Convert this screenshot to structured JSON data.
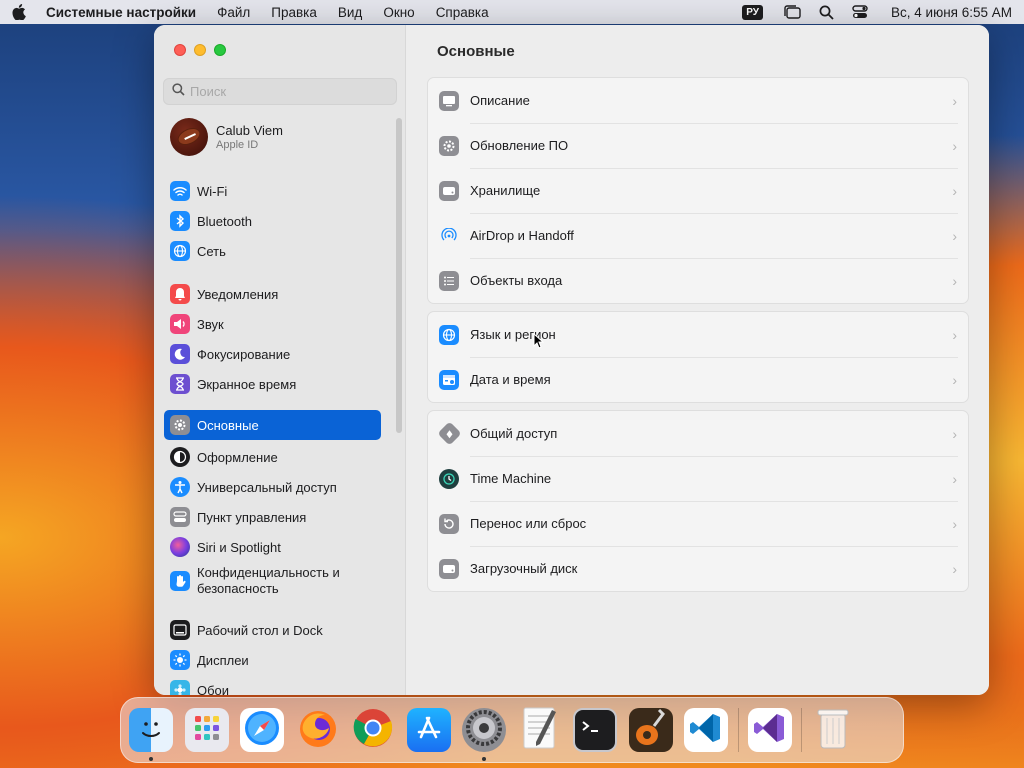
{
  "menubar": {
    "app_name": "Системные настройки",
    "menus": [
      "Файл",
      "Правка",
      "Вид",
      "Окно",
      "Справка"
    ],
    "input_lang": "РУ",
    "clock": "Вс, 4 июня  6:55 AM"
  },
  "sidebar": {
    "search_placeholder": "Поиск",
    "account": {
      "name": "Calub Viem",
      "subtitle": "Apple ID"
    },
    "items": [
      {
        "label": "Wi-Fi",
        "icon": "wifi-icon",
        "color": "#1a8cff"
      },
      {
        "label": "Bluetooth",
        "icon": "bluetooth-icon",
        "color": "#1a8cff"
      },
      {
        "label": "Сеть",
        "icon": "globe-icon",
        "color": "#1a8cff"
      },
      {
        "label": "Уведомления",
        "icon": "bell-icon",
        "color": "#f44b4b"
      },
      {
        "label": "Звук",
        "icon": "speaker-icon",
        "color": "#f0457a"
      },
      {
        "label": "Фокусирование",
        "icon": "moon-icon",
        "color": "#5b4fd9"
      },
      {
        "label": "Экранное время",
        "icon": "hourglass-icon",
        "color": "#6d4fd0"
      },
      {
        "label": "Основные",
        "icon": "gear-icon",
        "color": "#8e8e93",
        "active": true
      },
      {
        "label": "Оформление",
        "icon": "appearance-icon",
        "color": "#1d1d1f"
      },
      {
        "label": "Универсальный доступ",
        "icon": "accessibility-icon",
        "color": "#1a8cff"
      },
      {
        "label": "Пункт управления",
        "icon": "control-center-icon",
        "color": "#8e8e93"
      },
      {
        "label": "Siri и Spotlight",
        "icon": "siri-icon",
        "color": "#9b44d8"
      },
      {
        "label": "Конфиденциальность и безопасность",
        "icon": "hand-icon",
        "color": "#1a8cff"
      },
      {
        "label": "Рабочий стол и Dock",
        "icon": "dock-icon",
        "color": "#1d1d1f"
      },
      {
        "label": "Дисплеи",
        "icon": "sun-icon",
        "color": "#1a8cff"
      },
      {
        "label": "Обои",
        "icon": "wallpaper-icon",
        "color": "#35b6e8"
      }
    ]
  },
  "content": {
    "title": "Основные",
    "groups": [
      [
        {
          "label": "Описание",
          "icon": "display-icon"
        },
        {
          "label": "Обновление ПО",
          "icon": "update-gear-icon"
        },
        {
          "label": "Хранилище",
          "icon": "storage-icon"
        },
        {
          "label": "AirDrop и Handoff",
          "icon": "airdrop-icon"
        },
        {
          "label": "Объекты входа",
          "icon": "list-icon"
        }
      ],
      [
        {
          "label": "Язык и регион",
          "icon": "language-globe-icon"
        },
        {
          "label": "Дата и время",
          "icon": "calendar-clock-icon"
        }
      ],
      [
        {
          "label": "Общий доступ",
          "icon": "sharing-icon"
        },
        {
          "label": "Time Machine",
          "icon": "time-machine-icon"
        },
        {
          "label": "Перенос или сброс",
          "icon": "reset-icon"
        },
        {
          "label": "Загрузочный диск",
          "icon": "disk-icon"
        }
      ]
    ]
  },
  "dock": {
    "apps": [
      {
        "name": "Finder",
        "icon": "finder-icon",
        "running": true
      },
      {
        "name": "Launchpad",
        "icon": "launchpad-icon"
      },
      {
        "name": "Safari",
        "icon": "safari-icon"
      },
      {
        "name": "Firefox",
        "icon": "firefox-icon"
      },
      {
        "name": "Chrome",
        "icon": "chrome-icon"
      },
      {
        "name": "App Store",
        "icon": "app-store-icon"
      },
      {
        "name": "System Settings",
        "icon": "system-settings-icon",
        "running": true
      },
      {
        "name": "TextEdit",
        "icon": "textedit-icon"
      },
      {
        "name": "Terminal",
        "icon": "terminal-icon"
      },
      {
        "name": "GarageBand",
        "icon": "garageband-icon"
      },
      {
        "name": "VS Code",
        "icon": "vscode-icon"
      },
      {
        "name": "Visual Studio",
        "icon": "visual-studio-icon"
      },
      {
        "name": "Trash",
        "icon": "trash-icon"
      }
    ]
  }
}
